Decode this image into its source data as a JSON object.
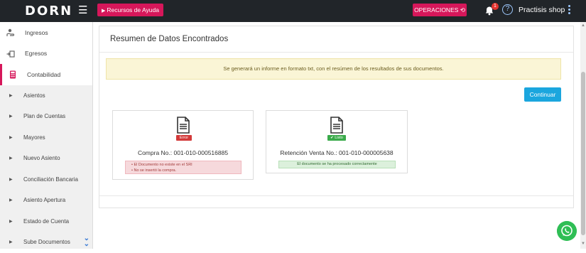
{
  "header": {
    "logo": "DORN",
    "help_button": "Recursos de Ayuda",
    "operations_button": "OPERACIONES",
    "notification_count": "1",
    "help_icon_text": "?",
    "user_name": "Practisis shop"
  },
  "sidebar": {
    "top_items": [
      {
        "label": "Ingresos",
        "icon": "money-hand-icon"
      },
      {
        "label": "Egresos",
        "icon": "money-out-icon"
      },
      {
        "label": "Contabilidad",
        "icon": "calculator-icon"
      }
    ],
    "sub_items": [
      "Asientos",
      "Plan de Cuentas",
      "Mayores",
      "Nuevo Asiento",
      "Conciliación Bancaria",
      "Asiento Apertura",
      "Estado de Cuenta",
      "Sube Documentos"
    ]
  },
  "main": {
    "title": "Resumen de Datos Encontrados",
    "info_message": "Se generará un informe en formato txt, con el resúmen de los resultados de sus documentos.",
    "continue_button": "Continuar",
    "cards": [
      {
        "badge": "Error",
        "title": "Compra No.: 001-010-000516885",
        "messages": [
          "El Documento no existe en el SRI",
          "No se insertó la compra."
        ]
      },
      {
        "badge": "Listo",
        "title": "Retención Venta No.: 001-010-000005638",
        "messages": [
          "El documento se ha procesado correctamente"
        ]
      }
    ]
  },
  "colors": {
    "accent": "#d6175a",
    "topbar": "#212529",
    "button_blue": "#1ba6de",
    "error": "#d33a3a",
    "success": "#3aaa4a",
    "whatsapp": "#2fbe55"
  }
}
